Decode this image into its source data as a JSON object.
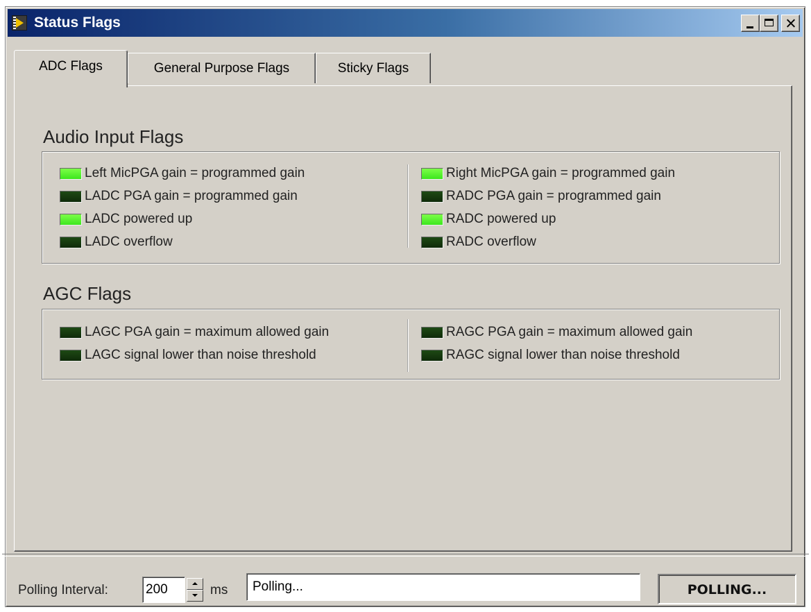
{
  "window": {
    "title": "Status Flags",
    "icon": "labview-icon",
    "controls": [
      "minimize",
      "maximize",
      "close"
    ]
  },
  "tabs": [
    {
      "label": "ADC Flags",
      "active": true
    },
    {
      "label": "General Purpose Flags",
      "active": false
    },
    {
      "label": "Sticky Flags",
      "active": false
    }
  ],
  "sections": {
    "audio": {
      "title": "Audio Input Flags",
      "left": [
        {
          "label": "Left MicPGA gain = programmed gain",
          "state": "on"
        },
        {
          "label": "LADC PGA gain = programmed gain",
          "state": "off"
        },
        {
          "label": "LADC powered up",
          "state": "on"
        },
        {
          "label": "LADC overflow",
          "state": "off"
        }
      ],
      "right": [
        {
          "label": "Right MicPGA gain = programmed gain",
          "state": "on"
        },
        {
          "label": "RADC PGA gain = programmed gain",
          "state": "off"
        },
        {
          "label": "RADC powered up",
          "state": "on"
        },
        {
          "label": "RADC overflow",
          "state": "off"
        }
      ]
    },
    "agc": {
      "title": "AGC Flags",
      "left": [
        {
          "label": "LAGC PGA gain = maximum allowed gain",
          "state": "off"
        },
        {
          "label": "LAGC signal lower than noise threshold",
          "state": "off"
        }
      ],
      "right": [
        {
          "label": "RAGC PGA gain = maximum allowed gain",
          "state": "off"
        },
        {
          "label": "RAGC signal lower than noise threshold",
          "state": "off"
        }
      ]
    }
  },
  "footer": {
    "polling_label": "Polling Interval:",
    "interval_value": "200",
    "unit": "ms",
    "status_text": "Polling...",
    "button_label": "POLLING..."
  },
  "colors": {
    "led_on": "#4ef02a",
    "led_off": "#143a0c",
    "title_bar": "#0a246a"
  }
}
